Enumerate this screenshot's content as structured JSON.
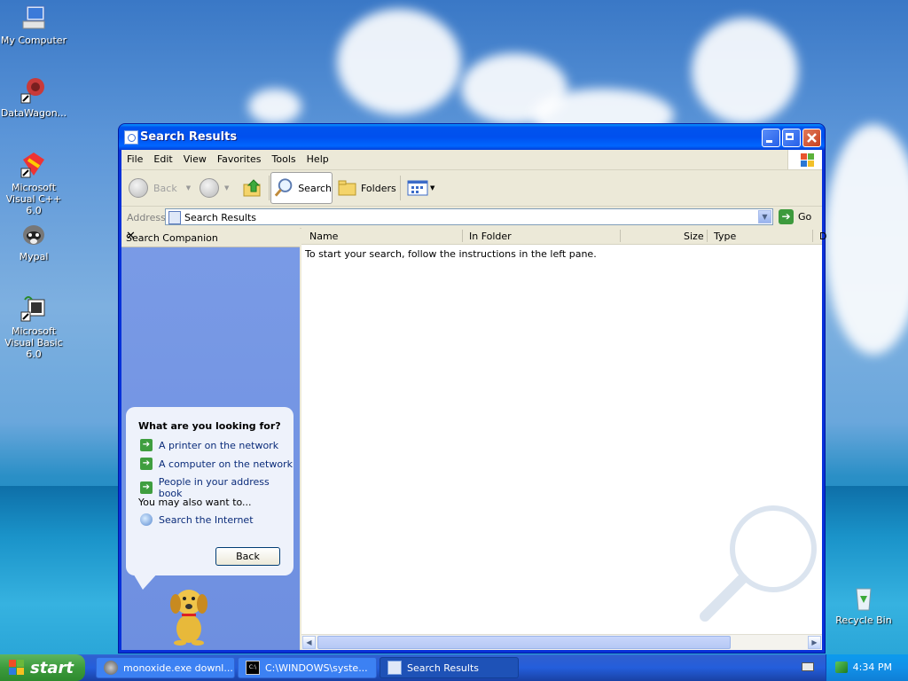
{
  "desktop": {
    "icons": [
      {
        "label": "My Computer"
      },
      {
        "label": "DataWagon..."
      },
      {
        "label": "Microsoft Visual C++ 6.0"
      },
      {
        "label": "Mypal"
      },
      {
        "label": "Microsoft Visual Basic 6.0"
      },
      {
        "label": "Recycle Bin"
      }
    ]
  },
  "window": {
    "title": "Search Results",
    "menu": [
      "File",
      "Edit",
      "View",
      "Favorites",
      "Tools",
      "Help"
    ],
    "toolbar": {
      "back": "Back",
      "search": "Search",
      "folders": "Folders"
    },
    "address": {
      "label": "Address",
      "value": "Search Results",
      "go": "Go"
    },
    "companion": {
      "header": "Search Companion",
      "question": "What are you looking for?",
      "options": [
        "A printer on the network",
        "A computer on the network",
        "People in your address book"
      ],
      "also": "You may also want to...",
      "internet": "Search the Internet",
      "back_button": "Back"
    },
    "results": {
      "columns": [
        "Name",
        "In Folder",
        "Size",
        "Type",
        "D"
      ],
      "message": "To start your search, follow the instructions in the left pane."
    }
  },
  "taskbar": {
    "start": "start",
    "tasks": [
      {
        "label": "monoxide.exe downl...",
        "active": false
      },
      {
        "label": "C:\\WINDOWS\\syste...",
        "active": false
      },
      {
        "label": "Search Results",
        "active": true
      }
    ],
    "clock": "4:34 PM"
  },
  "colors": {
    "titlebar": "#0053ee",
    "taskbar": "#245edb",
    "start": "#3c9b3c",
    "companion_pane": "#7a9be6"
  }
}
